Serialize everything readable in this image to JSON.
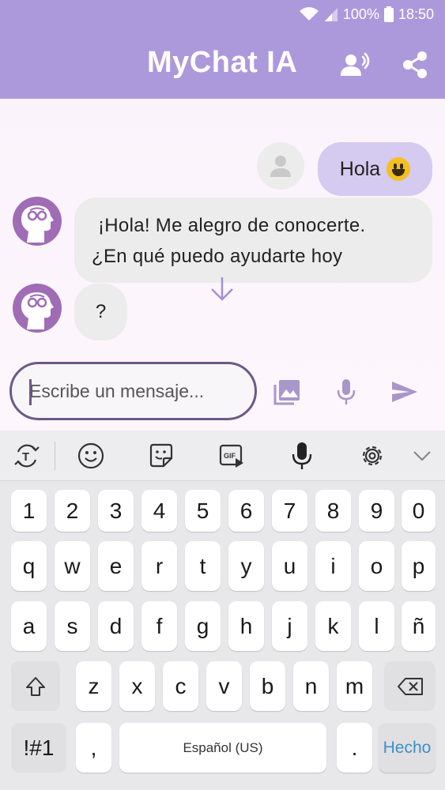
{
  "status_bar": {
    "battery": "100%",
    "time": "18:50"
  },
  "header": {
    "title": "MyChat IA",
    "voice_icon": "voice-chat-icon",
    "share_icon": "share-icon"
  },
  "chat": {
    "user_message": "Hola",
    "user_emoji": "grinning-face",
    "bot_message_line1": "¡Hola! Me alegro de conocerte.",
    "bot_message_line2": "¿En qué puedo ayudarte hoy",
    "bot_message2": "?"
  },
  "composer": {
    "placeholder": "Escribe un mensaje...",
    "gallery_icon": "image-icon",
    "mic_icon": "microphone-icon",
    "send_icon": "send-icon"
  },
  "keyboard": {
    "toolbar": [
      "text-mode-icon",
      "emoji-icon",
      "sticker-icon",
      "gif-icon",
      "voice-input-icon",
      "settings-icon",
      "collapse-icon"
    ],
    "row_numbers": [
      "1",
      "2",
      "3",
      "4",
      "5",
      "6",
      "7",
      "8",
      "9",
      "0"
    ],
    "row_1": [
      "q",
      "w",
      "e",
      "r",
      "t",
      "y",
      "u",
      "i",
      "o",
      "p"
    ],
    "row_2": [
      "a",
      "s",
      "d",
      "f",
      "g",
      "h",
      "j",
      "k",
      "l",
      "ñ"
    ],
    "row_3": [
      "z",
      "x",
      "c",
      "v",
      "b",
      "n",
      "m"
    ],
    "symbols_label": "!#1",
    "comma_label": ",",
    "space_label": "Español (US)",
    "period_label": ".",
    "done_label": "Hecho"
  },
  "colors": {
    "header_bg": "#ac99dc",
    "user_bubble": "#d5caef",
    "bot_bubble": "#ececec",
    "accent": "#6b5a86",
    "done_text": "#3d8fc8"
  }
}
